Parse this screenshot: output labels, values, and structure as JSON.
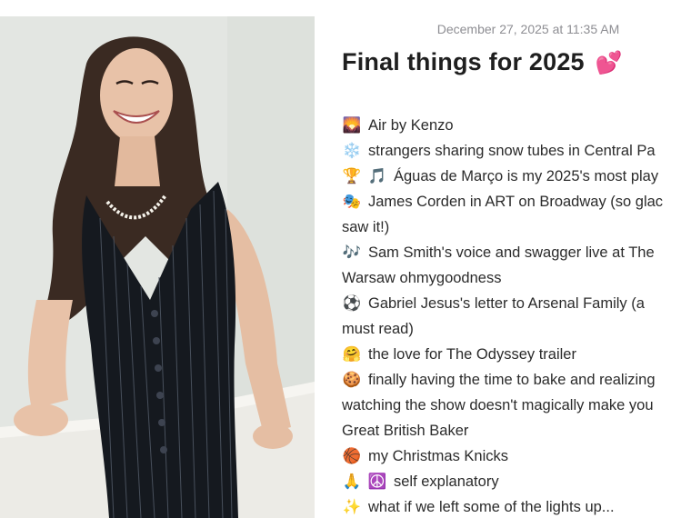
{
  "note": {
    "date": "December 27, 2025 at 11:35 AM",
    "title": "Final things for 2025",
    "title_emoji": "💕",
    "lines": [
      {
        "emoji": "🌄",
        "text": "Air by Kenzo"
      },
      {
        "emoji": "❄️",
        "text": "strangers sharing snow tubes in Central Pa"
      },
      {
        "emoji": "🏆",
        "emoji2": "🎵",
        "text": "Águas de Março is my 2025's most play"
      },
      {
        "emoji": "🎭",
        "text": "James Corden in ART on Broadway (so glac"
      },
      {
        "text": "saw it!)"
      },
      {
        "emoji": "🎶",
        "text": "Sam Smith's voice and swagger live at The"
      },
      {
        "text": "Warsaw ohmygoodness"
      },
      {
        "emoji": "⚽",
        "text": "Gabriel Jesus's letter to Arsenal Family (a"
      },
      {
        "text": "must read)"
      },
      {
        "emoji": "🤗",
        "text": "the love for The Odyssey trailer"
      },
      {
        "emoji": "🍪",
        "text": "finally having the time to bake and realizing"
      },
      {
        "text": "watching the show doesn't magically make you"
      },
      {
        "text": "Great British Baker"
      },
      {
        "emoji": "🏀",
        "text": "my Christmas Knicks"
      },
      {
        "emoji": "🙏",
        "emoji2": "☮️",
        "text": "self explanatory"
      },
      {
        "emoji": "✨",
        "text": "what if we left some of the lights up..."
      }
    ]
  },
  "colors": {
    "background": "#ffffff",
    "date_text": "#8e8e93",
    "title_text": "#1f1f1f",
    "body_text": "#2b2b2b"
  }
}
